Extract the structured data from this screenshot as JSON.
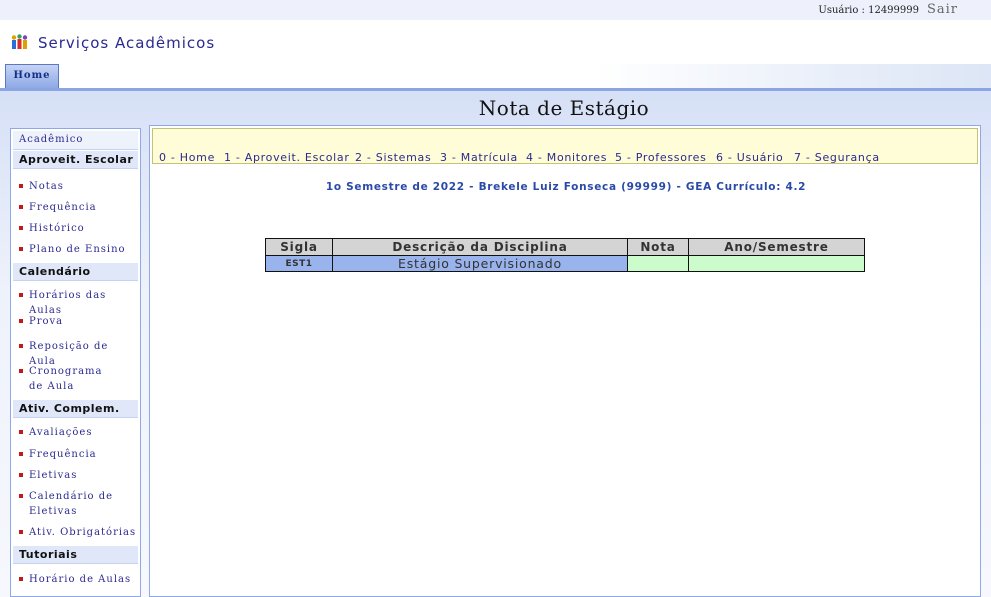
{
  "header": {
    "user_label": "Usuário : 12499999",
    "logout_label": "Sair",
    "app_title": "Serviços Acadêmicos",
    "home_tab": "Home"
  },
  "page": {
    "title": "Nota de Estágio"
  },
  "sidebar": {
    "top_label": "Acadêmico",
    "sections": [
      {
        "title": "Aproveit. Escolar",
        "items": [
          "Notas",
          "Frequência",
          "Histórico",
          "Plano de Ensino"
        ]
      },
      {
        "title": "Calendário",
        "items": [
          "Horários das Aulas",
          "Prova",
          "Reposição de Aula",
          "Cronograma de Aula"
        ]
      },
      {
        "title": "Ativ. Complem.",
        "items": [
          "Avaliações",
          "Frequência",
          "Eletivas",
          "Calendário de Eletivas",
          "Ativ. Obrigatórias"
        ]
      },
      {
        "title": "Tutoriais",
        "items": [
          "Horário de Aulas"
        ]
      }
    ]
  },
  "menu": {
    "items": [
      "0 - Home",
      "1 - Aproveit. Escolar",
      "2 - Sistemas",
      "3 - Matrícula",
      "4 - Monitores",
      "5 - Professores",
      "6 - Usuário",
      "7 - Segurança"
    ]
  },
  "info": {
    "line": "1o Semestre de 2022 - Brekele Luiz Fonseca (99999) - GEA Currículo: 4.2"
  },
  "grades_table": {
    "headers": [
      "Sigla",
      "Descrição da Disciplina",
      "Nota",
      "Ano/Semestre"
    ],
    "rows": [
      {
        "sigla": "EST1",
        "descricao": "Estágio Supervisionado",
        "nota": "",
        "ano_semestre": ""
      }
    ]
  },
  "colors": {
    "link": "#2b2a8f",
    "bullet": "#c21a1a",
    "menu_bg": "#fffdd8",
    "row_blue": "#99b3ec",
    "row_green": "#ccfccc"
  }
}
